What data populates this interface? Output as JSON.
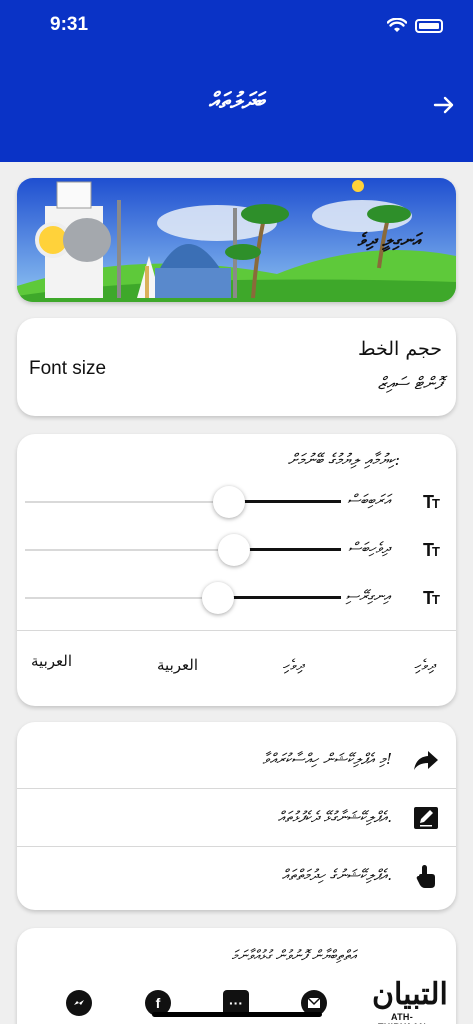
{
  "status_bar": {
    "time": "9:31",
    "icons": [
      "wifi-icon",
      "battery-icon"
    ]
  },
  "header": {
    "title": "ބަދަލުތައް",
    "back_icon": "arrow-right-icon",
    "background": "#0a33c6"
  },
  "banner": {
    "text": "އަނގިލީ ދިވެ"
  },
  "font_size": {
    "label_en": "Font size",
    "label_ar": "حجم الخط",
    "label_dv": "ފޮންޓް ސައިޒް"
  },
  "sliders": {
    "title": "ކިޔުމާއި ލިޔުމުގެ ބޭނުމަށް:",
    "items": [
      {
        "label": "އަރަބިބަސް",
        "value": 0.645
      },
      {
        "label": "ދިވެހިބަސް",
        "value": 0.66
      },
      {
        "label": "އިނގިރޭސި",
        "value": 0.61
      }
    ],
    "preview": [
      "ދިވެހި",
      "ދިވެހި",
      "العربية",
      "العربية"
    ]
  },
  "actions": [
    {
      "icon": "share-icon",
      "text": "މި އެޕްލިކޭޝަން ހިއްސާކުރައްވާ!"
    },
    {
      "icon": "edit-icon",
      "text": "އެޕްލިކޭޝަނާގުޅޭ ދެކެފުޅުތައް."
    },
    {
      "icon": "tap-icon",
      "text": "އެޕްލިކޭޝަނުގެ ހިދުމަތްތައް."
    }
  ],
  "footer": {
    "title": "އަތްތިބްޔާން ފޮނުވުން ގުޅުއްވާނަމަ",
    "logo_ar": "التبيان",
    "logo_en": "ATH-THIBYAAN",
    "social": [
      "messenger-icon",
      "facebook-icon",
      "more-icon",
      "email-icon"
    ]
  }
}
